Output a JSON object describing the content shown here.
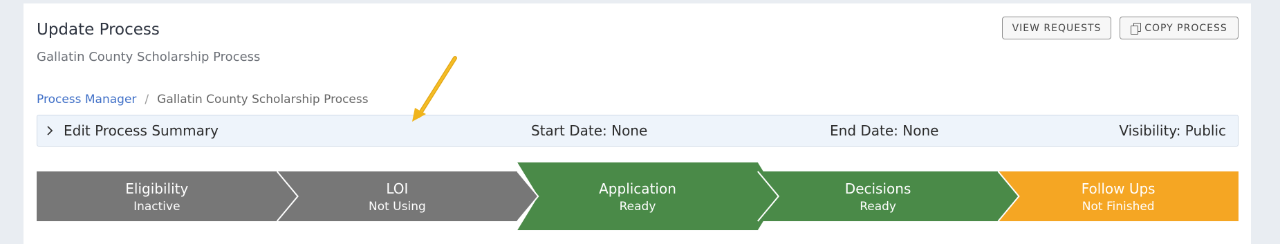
{
  "header": {
    "title": "Update Process",
    "subtitle": "Gallatin County Scholarship Process"
  },
  "actions": {
    "view_requests": "VIEW REQUESTS",
    "copy_process": "COPY PROCESS"
  },
  "breadcrumb": {
    "root": "Process Manager",
    "separator": "/",
    "current": "Gallatin County Scholarship Process"
  },
  "summary": {
    "toggle_label": "Edit Process Summary",
    "start_date": "Start Date: None",
    "end_date": "End Date: None",
    "visibility": "Visibility: Public"
  },
  "steps": [
    {
      "name": "Eligibility",
      "status": "Inactive",
      "color": "#777777"
    },
    {
      "name": "LOI",
      "status": "Not Using",
      "color": "#777777"
    },
    {
      "name": "Application",
      "status": "Ready",
      "color": "#4a8a48",
      "active": true
    },
    {
      "name": "Decisions",
      "status": "Ready",
      "color": "#4a8a48"
    },
    {
      "name": "Follow Ups",
      "status": "Not Finished",
      "color": "#f5a623"
    }
  ],
  "colors": {
    "inactive": "#777777",
    "ready": "#4a8a48",
    "pending": "#f5a623",
    "link": "#3f6fc7",
    "annotation_arrow": "#f0b41c"
  },
  "icons": {
    "copy": "copy-icon",
    "expand": "chevron-right-icon",
    "annotation": "pointer-arrow-icon"
  }
}
